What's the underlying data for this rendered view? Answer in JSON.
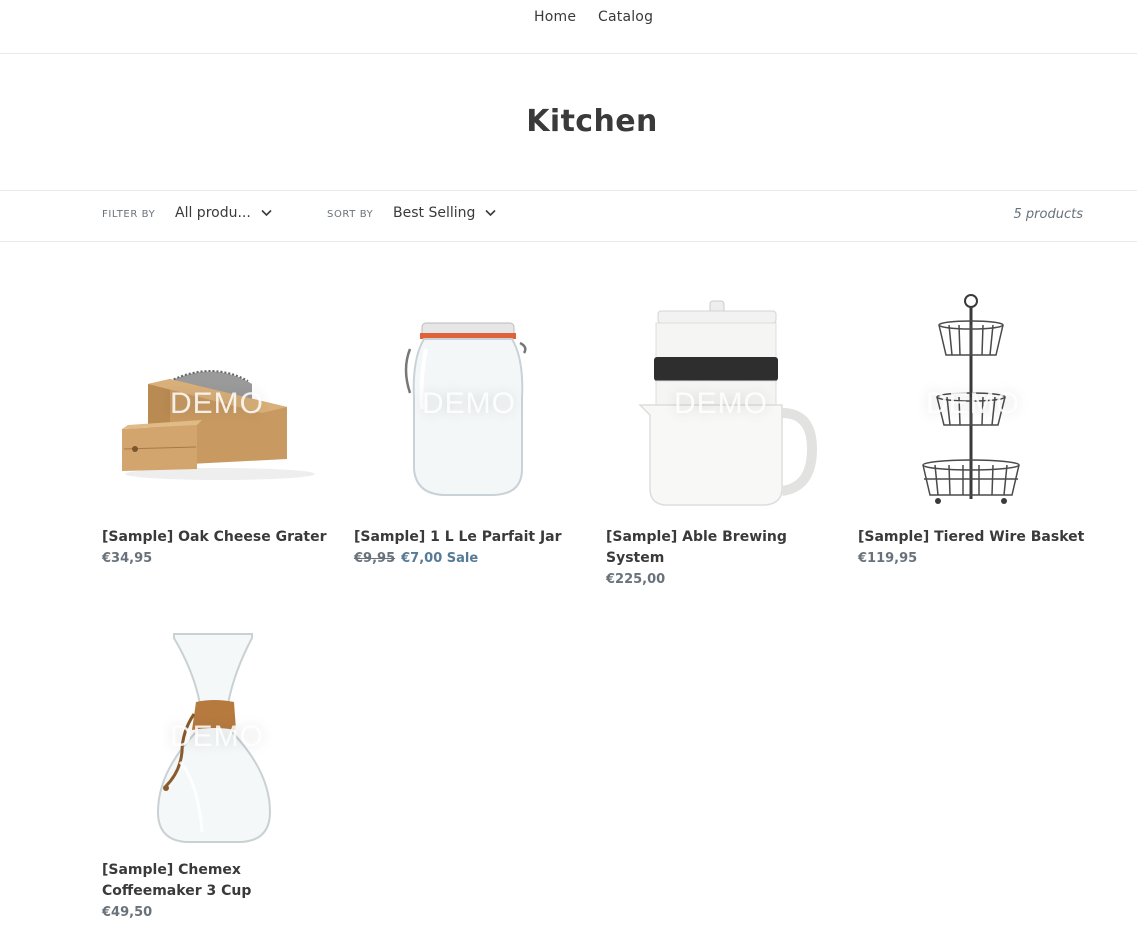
{
  "nav": {
    "home": "Home",
    "catalog": "Catalog"
  },
  "collection": {
    "title": "Kitchen"
  },
  "filters": {
    "filter_label": "FILTER BY",
    "filter_value": "All produ...",
    "sort_label": "SORT BY",
    "sort_value": "Best Selling",
    "count": "5 products"
  },
  "watermark": "DEMO",
  "products": [
    {
      "title": "[Sample] Oak Cheese Grater",
      "price": "€34,95",
      "icon": "cheese-grater-image"
    },
    {
      "title": "[Sample] 1 L Le Parfait Jar",
      "compare_price": "€9,95",
      "sale_price": "€7,00",
      "sale_badge": "Sale",
      "icon": "jar-image"
    },
    {
      "title": "[Sample] Able Brewing System",
      "price": "€225,00",
      "icon": "brewing-system-image"
    },
    {
      "title": "[Sample] Tiered Wire Basket",
      "price": "€119,95",
      "icon": "wire-basket-image"
    },
    {
      "title": "[Sample] Chemex Coffeemaker 3 Cup",
      "price": "€49,50",
      "icon": "chemex-image"
    }
  ],
  "colors": {
    "text": "#3a3a3a",
    "muted": "#69727b",
    "sale": "#557b97",
    "border": "#e8e9eb"
  }
}
